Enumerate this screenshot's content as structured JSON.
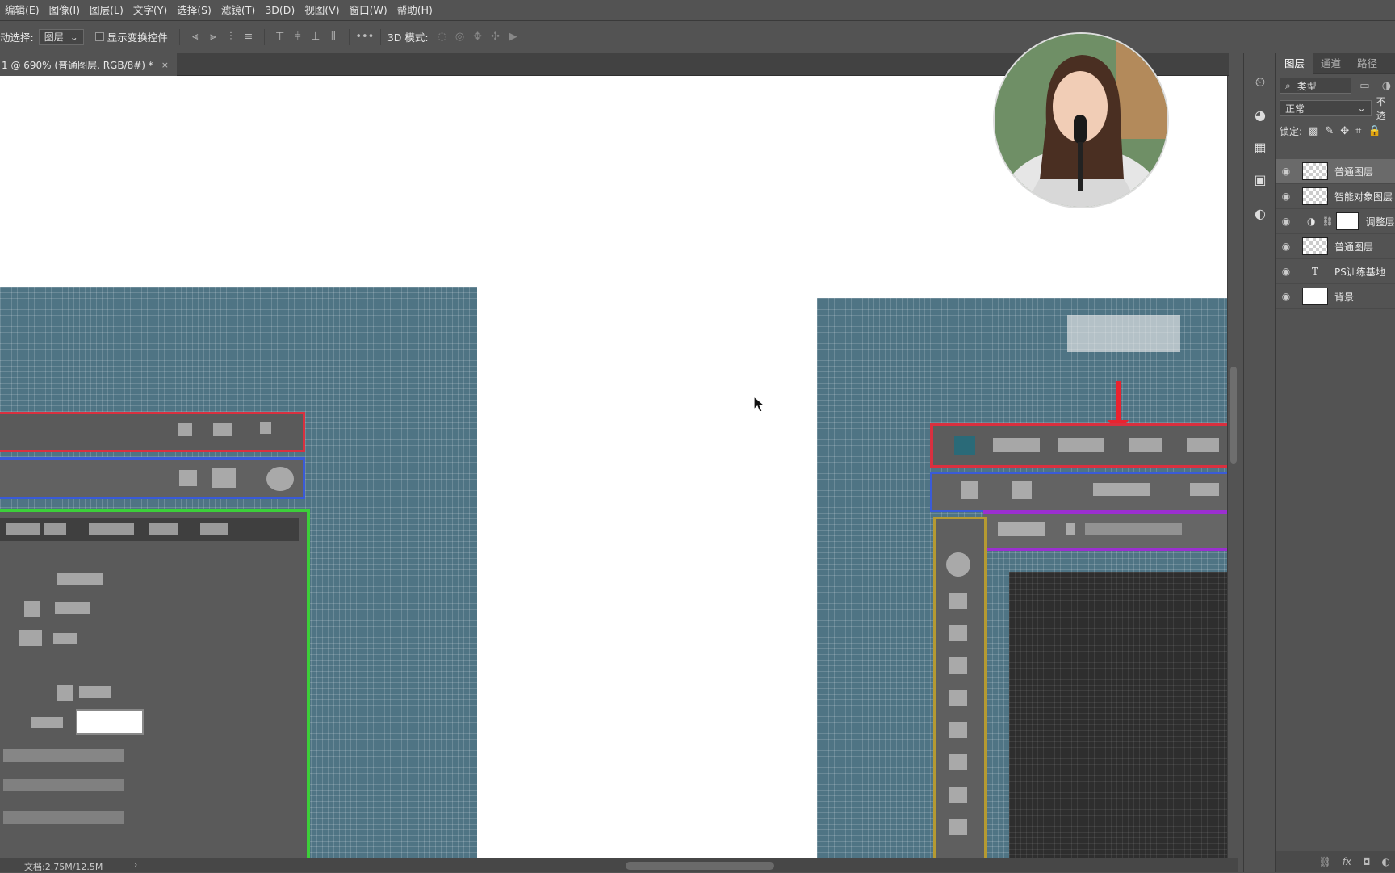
{
  "menu": [
    "编辑(E)",
    "图像(I)",
    "图层(L)",
    "文字(Y)",
    "选择(S)",
    "滤镜(T)",
    "3D(D)",
    "视图(V)",
    "窗口(W)",
    "帮助(H)"
  ],
  "options": {
    "auto_select_label": "动选择:",
    "auto_select_value": "图层",
    "show_transform_label": "显示变换控件",
    "mode_3d_label": "3D 模式:"
  },
  "document": {
    "tab_title": "1 @ 690% (普通图层, RGB/8#) *",
    "close": "×"
  },
  "status": {
    "doc_size": "文档:2.75M/12.5M",
    "arrow": "›"
  },
  "layers_panel": {
    "tabs": [
      "图层",
      "通道",
      "路径"
    ],
    "filter_label": "类型",
    "blend_mode": "正常",
    "opacity_label": "不透",
    "lock_label": "锁定:",
    "layers": [
      {
        "name": "普通图层",
        "selected": true
      },
      {
        "name": "智能对象图层",
        "selected": false
      },
      {
        "name": "调整层",
        "selected": false
      },
      {
        "name": "普通图层",
        "selected": false
      },
      {
        "name": "PS训练基地",
        "selected": false
      },
      {
        "name": "背景",
        "selected": false
      }
    ],
    "footer_icons": [
      "link-icon",
      "fx-icon",
      "mask-icon",
      "adjustment-icon"
    ]
  },
  "colors": {
    "canvas_bg": "#ffffff",
    "pixel_grid": "#4f7484",
    "red_box": "#d9303f",
    "blue_box": "#3a5bd8",
    "green_box": "#3ccf3a",
    "purple_box": "#9b2fd0",
    "gold_box": "#b59a32",
    "selected_layer": "#6a6a6a"
  }
}
